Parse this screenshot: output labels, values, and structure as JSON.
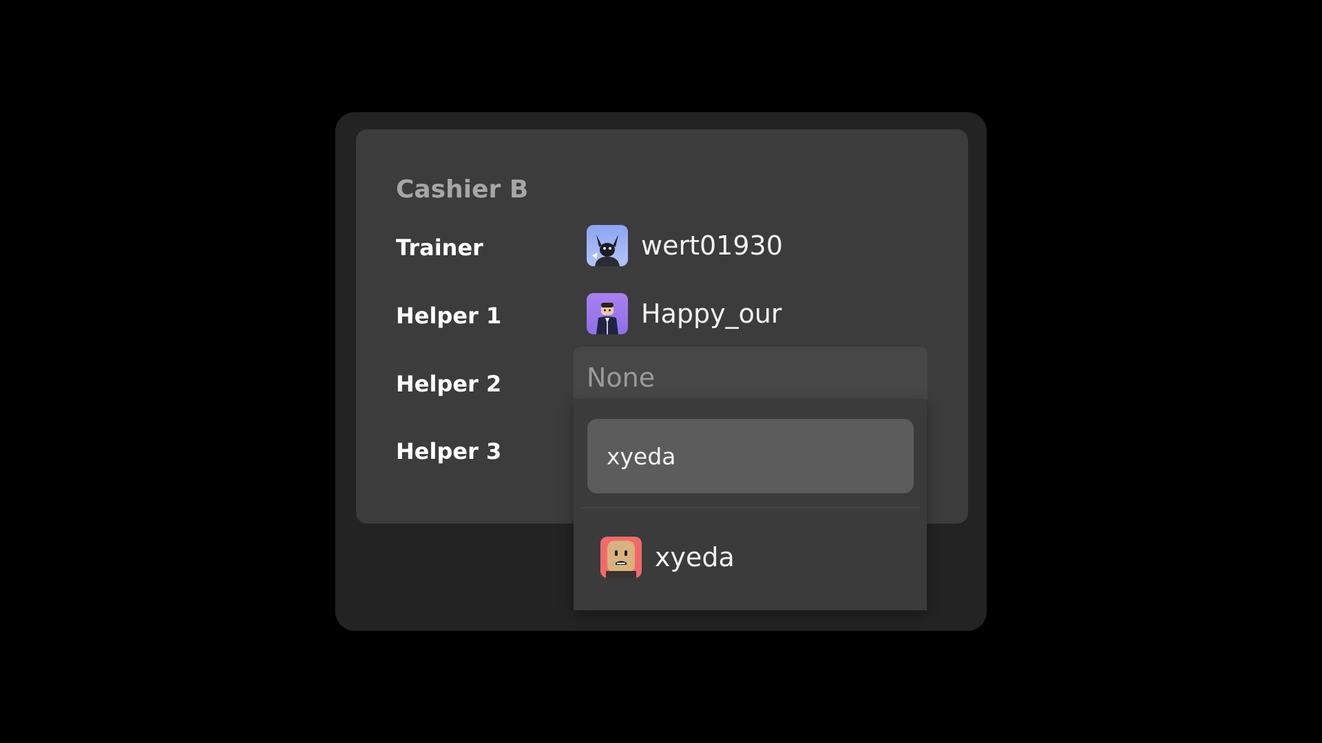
{
  "card": {
    "title": "Cashier B"
  },
  "rows": [
    {
      "label": "Trainer",
      "user": {
        "name": "wert01930",
        "avatar": "horned-character-avatar-icon"
      }
    },
    {
      "label": "Helper 1",
      "user": {
        "name": "Happy_our",
        "avatar": "suited-character-avatar-icon"
      }
    },
    {
      "label": "Helper 2",
      "select": {
        "value": "None"
      }
    },
    {
      "label": "Helper 3"
    }
  ],
  "dropdown": {
    "search": {
      "value": "xyeda"
    },
    "options": [
      {
        "name": "xyeda",
        "avatar": "blocky-face-avatar-icon"
      }
    ]
  },
  "colors": {
    "background": "#000000",
    "outer_panel": "#232323",
    "card": "#3c3c3c",
    "title": "#a6a6a6",
    "label": "#ffffff",
    "select_bg": "#474747",
    "dropdown_bg": "#3b3b3b",
    "search_bg": "#5c5c5c"
  }
}
